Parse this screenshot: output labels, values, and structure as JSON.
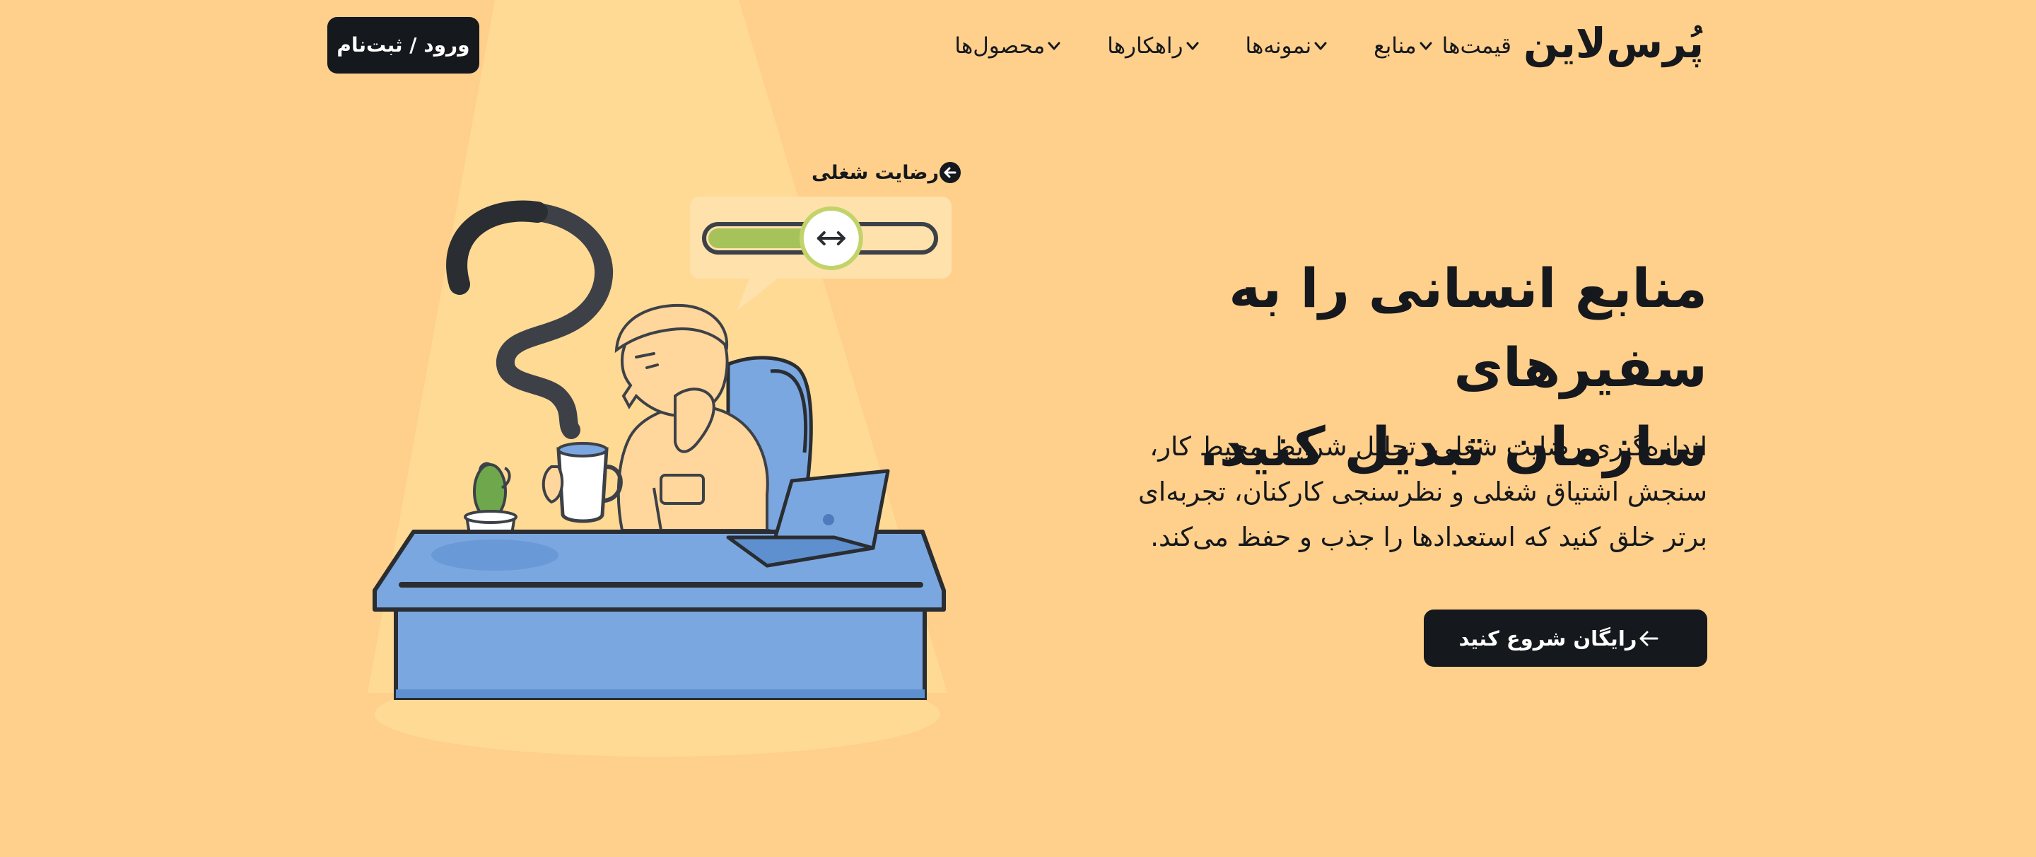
{
  "header": {
    "logo": "پُرس‌لاین",
    "nav": [
      {
        "label": "محصول‌ها",
        "has_dropdown": true,
        "icon": "chevron-down-icon"
      },
      {
        "label": "راهکارها",
        "has_dropdown": true,
        "icon": "chevron-down-icon"
      },
      {
        "label": "نمونه‌ها",
        "has_dropdown": true,
        "icon": "chevron-down-icon"
      },
      {
        "label": "منابع",
        "has_dropdown": true,
        "icon": "chevron-down-icon"
      },
      {
        "label": "قیمت‌ها",
        "has_dropdown": false
      }
    ],
    "login_label": "ورود / ثبت‌نام"
  },
  "hero": {
    "title_line1": "منابع انسانی را به سفیرهای",
    "title_line2": "سازمان تبدیل کنید.",
    "desc_line1": "اندازه‌گیری رضایت شغلی، تحلیل شرایط محیط کار،",
    "desc_line2": "سنجش اشتیاق شغلی و نظرسنجی کارکنان، تجربه‌ای",
    "desc_line3": "برتر خلق کنید که استعدادها را جذب و حفظ می‌کند.",
    "cta_label": "رایگان شروع کنید",
    "cta_icon": "arrow-left-icon"
  },
  "illustration": {
    "badge_label": "رضایت شغلی",
    "badge_icon": "arrow-left-circle-icon",
    "slider_level": 0.55,
    "slider_icon": "left-right-arrows-icon"
  },
  "colors": {
    "background": "#FFCF8C",
    "dark": "#15181C",
    "desk_blue": "#7BA7E0",
    "slider_green": "#A6C25A"
  }
}
